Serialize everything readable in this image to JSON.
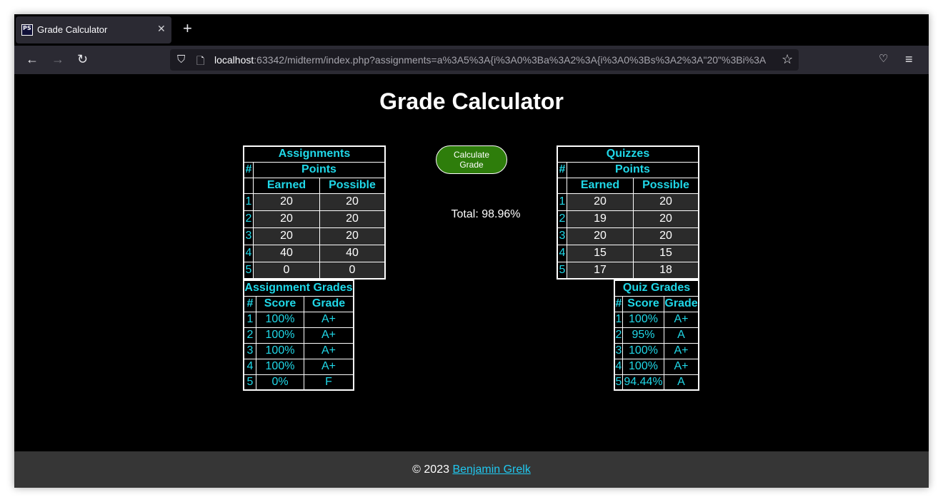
{
  "browser": {
    "tab_title": "Grade Calculator",
    "favicon_text": "PS",
    "url_host": "localhost",
    "url_rest": ":63342/midterm/index.php?assignments=a%3A5%3A{i%3A0%3Ba%3A2%3A{i%3A0%3Bs%3A2%3A\"20\"%3Bi%3A"
  },
  "page": {
    "title": "Grade Calculator",
    "calculate_button": "Calculate Grade",
    "total_text": "Total: 98.96%"
  },
  "assignments": {
    "title": "Assignments",
    "hash": "#",
    "points": "Points",
    "earned": "Earned",
    "possible": "Possible",
    "rows": [
      {
        "n": "1",
        "earned": "20",
        "possible": "20"
      },
      {
        "n": "2",
        "earned": "20",
        "possible": "20"
      },
      {
        "n": "3",
        "earned": "20",
        "possible": "20"
      },
      {
        "n": "4",
        "earned": "40",
        "possible": "40"
      },
      {
        "n": "5",
        "earned": "0",
        "possible": "0"
      }
    ]
  },
  "quizzes": {
    "title": "Quizzes",
    "hash": "#",
    "points": "Points",
    "earned": "Earned",
    "possible": "Possible",
    "rows": [
      {
        "n": "1",
        "earned": "20",
        "possible": "20"
      },
      {
        "n": "2",
        "earned": "19",
        "possible": "20"
      },
      {
        "n": "3",
        "earned": "20",
        "possible": "20"
      },
      {
        "n": "4",
        "earned": "15",
        "possible": "15"
      },
      {
        "n": "5",
        "earned": "17",
        "possible": "18"
      }
    ]
  },
  "assignment_grades": {
    "title": "Assignment Grades",
    "hash": "#",
    "score": "Score",
    "grade": "Grade",
    "rows": [
      {
        "n": "1",
        "score": "100%",
        "grade": "A+"
      },
      {
        "n": "2",
        "score": "100%",
        "grade": "A+"
      },
      {
        "n": "3",
        "score": "100%",
        "grade": "A+"
      },
      {
        "n": "4",
        "score": "100%",
        "grade": "A+"
      },
      {
        "n": "5",
        "score": "0%",
        "grade": "F"
      }
    ]
  },
  "quiz_grades": {
    "title": "Quiz Grades",
    "hash": "#",
    "score": "Score",
    "grade": "Grade",
    "rows": [
      {
        "n": "1",
        "score": "100%",
        "grade": "A+"
      },
      {
        "n": "2",
        "score": "95%",
        "grade": "A"
      },
      {
        "n": "3",
        "score": "100%",
        "grade": "A+"
      },
      {
        "n": "4",
        "score": "100%",
        "grade": "A+"
      },
      {
        "n": "5",
        "score": "94.44%",
        "grade": "A"
      }
    ]
  },
  "footer": {
    "copyright": "© 2023 ",
    "author": "Benjamin Grelk"
  },
  "colors": {
    "accent_text": "#20d8e8",
    "button_green": "#2e7d0b",
    "footer_bg": "#363636",
    "link": "#20c8f0"
  }
}
